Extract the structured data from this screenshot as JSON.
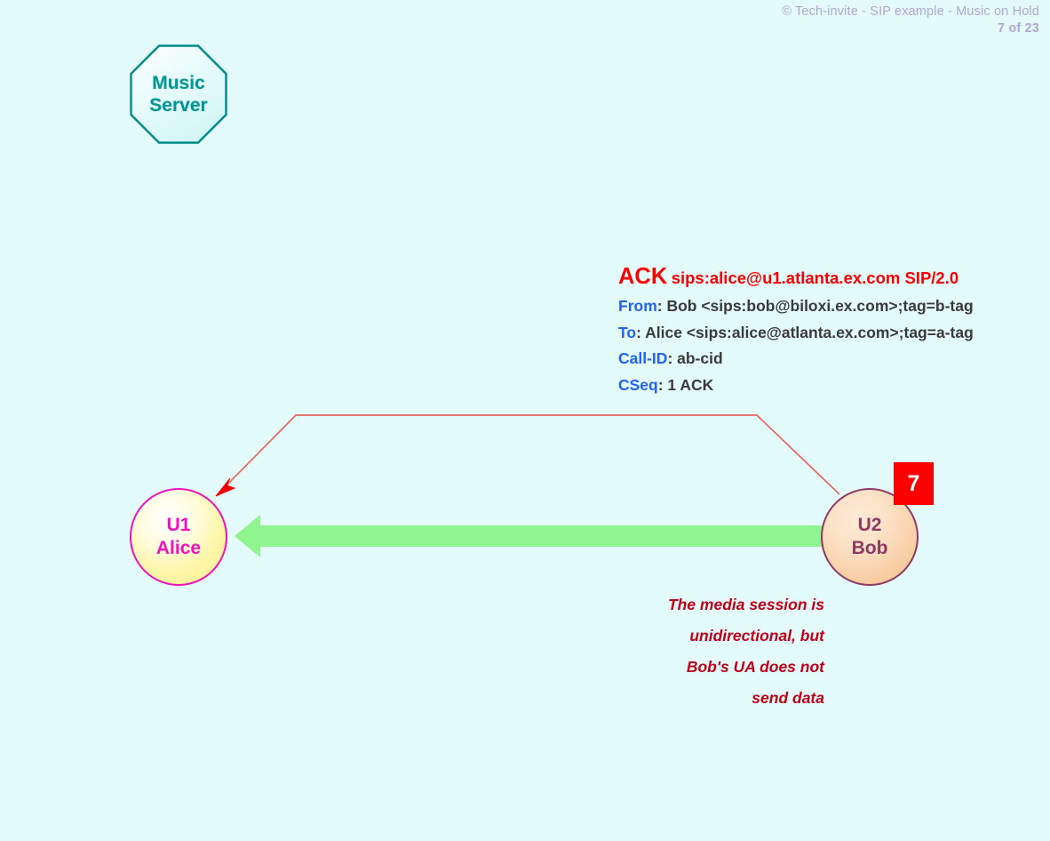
{
  "header": {
    "copyright": "© Tech-invite - SIP example - Music on Hold",
    "page_counter": "7 of 23"
  },
  "nodes": {
    "music_server": {
      "line1": "Music",
      "line2": "Server",
      "shape": "octagon",
      "border_color": "#008b8b",
      "fill_color": "#e6fbfb"
    },
    "alice": {
      "line1": "U1",
      "line2": "Alice",
      "shape": "circle",
      "border_color": "#f012be",
      "fill_color": "#fdf4a0"
    },
    "bob": {
      "line1": "U2",
      "line2": "Bob",
      "shape": "circle",
      "border_color": "#8e3a65",
      "fill_color": "#f8cba0"
    }
  },
  "step_badge": {
    "number": "7",
    "color": "#fc0000",
    "text_color": "#ffffff"
  },
  "sip_message": {
    "method": "ACK",
    "request_uri": "sips:alice@u1.atlanta.ex.com SIP/2.0",
    "method_color": "#fb0000",
    "header_name_color": "#1f63f0",
    "header_value_color": "#3a3a3a",
    "headers": [
      {
        "name": "From",
        "value": " Bob <sips:bob@biloxi.ex.com>;tag=b-tag"
      },
      {
        "name": "To",
        "value": " Alice <sips:alice@atlanta.ex.com>;tag=a-tag"
      },
      {
        "name": "Call-ID",
        "value": " ab-cid"
      },
      {
        "name": "CSeq",
        "value": " 1 ACK"
      }
    ]
  },
  "signal_arrow": {
    "label": "ACK signalling path from Bob to Alice",
    "direction": "right-to-left",
    "color": "#e8665f",
    "arrowhead_color": "#f40000"
  },
  "media_arrow": {
    "label": "media stream from Bob to Alice",
    "direction": "right-to-left",
    "color": "#90f58f"
  },
  "annotation": {
    "lines": [
      "The media session is",
      "unidirectional, but",
      "Bob's UA does not",
      "send data"
    ],
    "color": "#c00018"
  }
}
